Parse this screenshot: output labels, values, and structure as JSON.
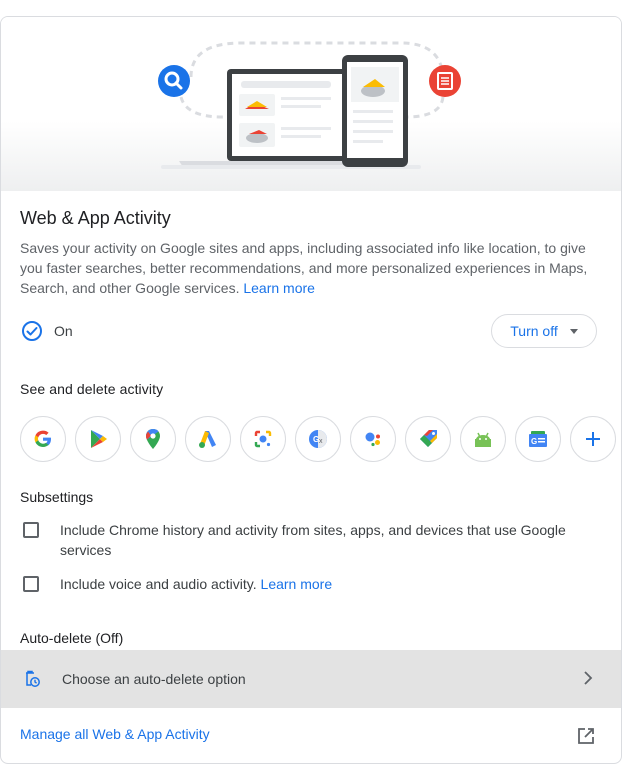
{
  "title": "Web & App Activity",
  "description": "Saves your activity on Google sites and apps, including associated info like location, to give you faster searches, better recommendations, and more personalized experiences in Maps, Search, and other Google services.",
  "description_link": "Learn more",
  "status": {
    "label": "On",
    "icon": "check-circle-icon"
  },
  "turn_off_label": "Turn off",
  "see_delete": {
    "heading": "See and delete activity",
    "apps": [
      {
        "name": "Google Search",
        "icon": "google-icon"
      },
      {
        "name": "Google Play",
        "icon": "play-icon"
      },
      {
        "name": "Google Maps",
        "icon": "maps-icon"
      },
      {
        "name": "Google Ads",
        "icon": "ads-icon"
      },
      {
        "name": "Google Lens",
        "icon": "lens-icon"
      },
      {
        "name": "Google Translate",
        "icon": "translate-icon"
      },
      {
        "name": "Google Assistant",
        "icon": "assistant-icon"
      },
      {
        "name": "Google Shopping",
        "icon": "shopping-icon"
      },
      {
        "name": "Android",
        "icon": "android-icon"
      },
      {
        "name": "Google News",
        "icon": "news-icon"
      },
      {
        "name": "More",
        "icon": "plus-icon"
      }
    ]
  },
  "subsettings": {
    "heading": "Subsettings",
    "chrome_label": "Include Chrome history and activity from sites, apps, and devices that use Google services",
    "voice_label": "Include voice and audio activity.",
    "voice_link": "Learn more"
  },
  "auto_delete": {
    "heading": "Auto-delete (Off)",
    "option_label": "Choose an auto-delete option"
  },
  "manage_label": "Manage all Web & App Activity",
  "colors": {
    "accent": "#1a73e8",
    "text": "#202124",
    "secondary": "#5f6368",
    "row_bg": "#e3e3e3"
  }
}
